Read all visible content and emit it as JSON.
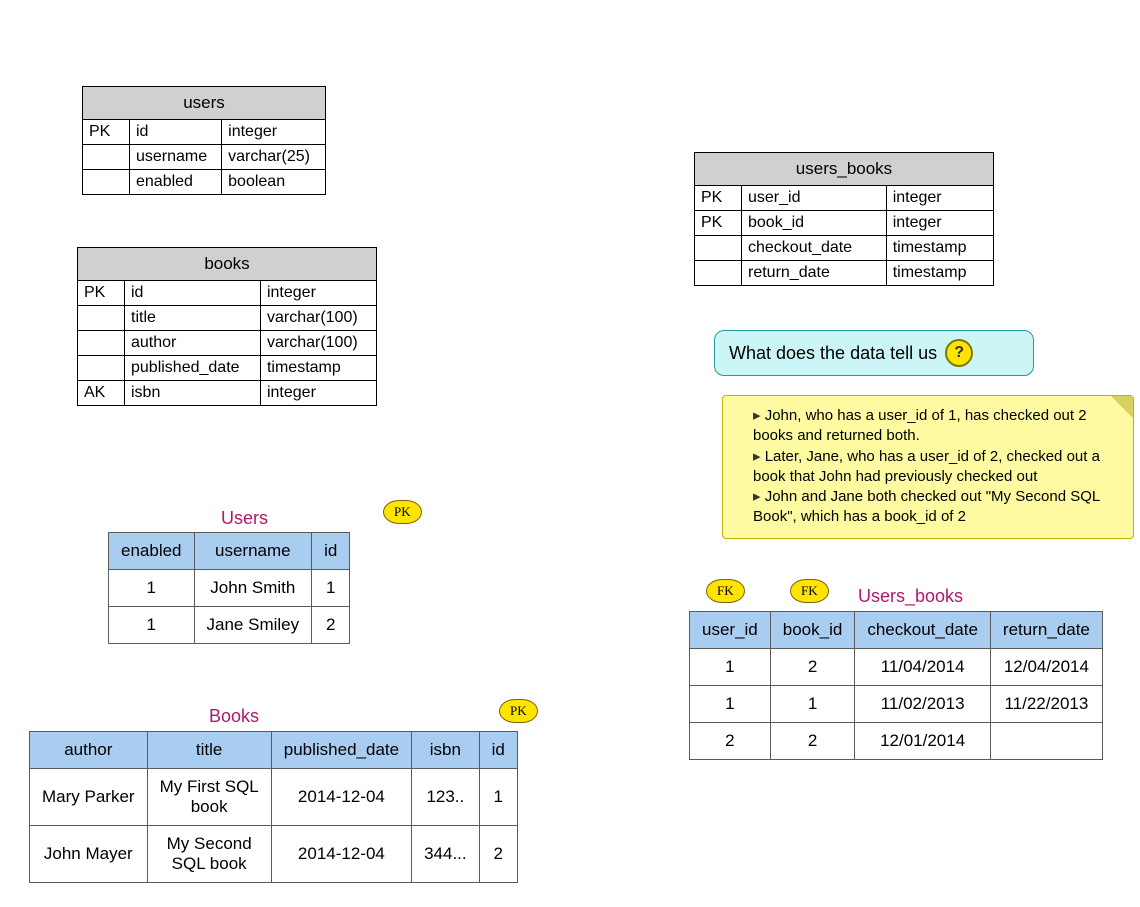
{
  "schema_users": {
    "title": "users",
    "rows": [
      {
        "key": "PK",
        "name": "id",
        "type": "integer"
      },
      {
        "key": "",
        "name": "username",
        "type": "varchar(25)"
      },
      {
        "key": "",
        "name": "enabled",
        "type": "boolean"
      }
    ]
  },
  "schema_books": {
    "title": "books",
    "rows": [
      {
        "key": "PK",
        "name": "id",
        "type": "integer"
      },
      {
        "key": "",
        "name": "title",
        "type": "varchar(100)"
      },
      {
        "key": "",
        "name": "author",
        "type": "varchar(100)"
      },
      {
        "key": "",
        "name": "published_date",
        "type": "timestamp"
      },
      {
        "key": "AK",
        "name": "isbn",
        "type": "integer"
      }
    ]
  },
  "schema_users_books": {
    "title": "users_books",
    "rows": [
      {
        "key": "PK",
        "name": "user_id",
        "type": "integer"
      },
      {
        "key": "PK",
        "name": "book_id",
        "type": "integer"
      },
      {
        "key": "",
        "name": "checkout_date",
        "type": "timestamp"
      },
      {
        "key": "",
        "name": "return_date",
        "type": "timestamp"
      }
    ]
  },
  "sample_users": {
    "title": "Users",
    "badge": "PK",
    "headers": [
      "enabled",
      "username",
      "id"
    ],
    "rows": [
      [
        "1",
        "John Smith",
        "1"
      ],
      [
        "1",
        "Jane Smiley",
        "2"
      ]
    ]
  },
  "sample_books": {
    "title": "Books",
    "badge": "PK",
    "headers": [
      "author",
      "title",
      "published_date",
      "isbn",
      "id"
    ],
    "rows": [
      [
        "Mary Parker",
        "My First SQL\nbook",
        "2014-12-04",
        "123..",
        "1"
      ],
      [
        "John Mayer",
        "My Second\nSQL book",
        "2014-12-04",
        "344...",
        "2"
      ]
    ]
  },
  "sample_users_books": {
    "title": "Users_books",
    "badge1": "FK",
    "badge2": "FK",
    "headers": [
      "user_id",
      "book_id",
      "checkout_date",
      "return_date"
    ],
    "rows": [
      [
        "1",
        "2",
        "11/04/2014",
        "12/04/2014"
      ],
      [
        "1",
        "1",
        "11/02/2013",
        "11/22/2013"
      ],
      [
        "2",
        "2",
        "12/01/2014",
        ""
      ]
    ]
  },
  "callout": {
    "text": "What does the data tell us"
  },
  "note": {
    "items": [
      "John, who has a user_id of 1, has checked out 2 books and returned both.",
      "Later, Jane, who has a user_id of 2, checked out a book that John had previously checked out",
      "John and Jane both checked out \"My Second SQL Book\", which has a book_id of 2"
    ]
  }
}
